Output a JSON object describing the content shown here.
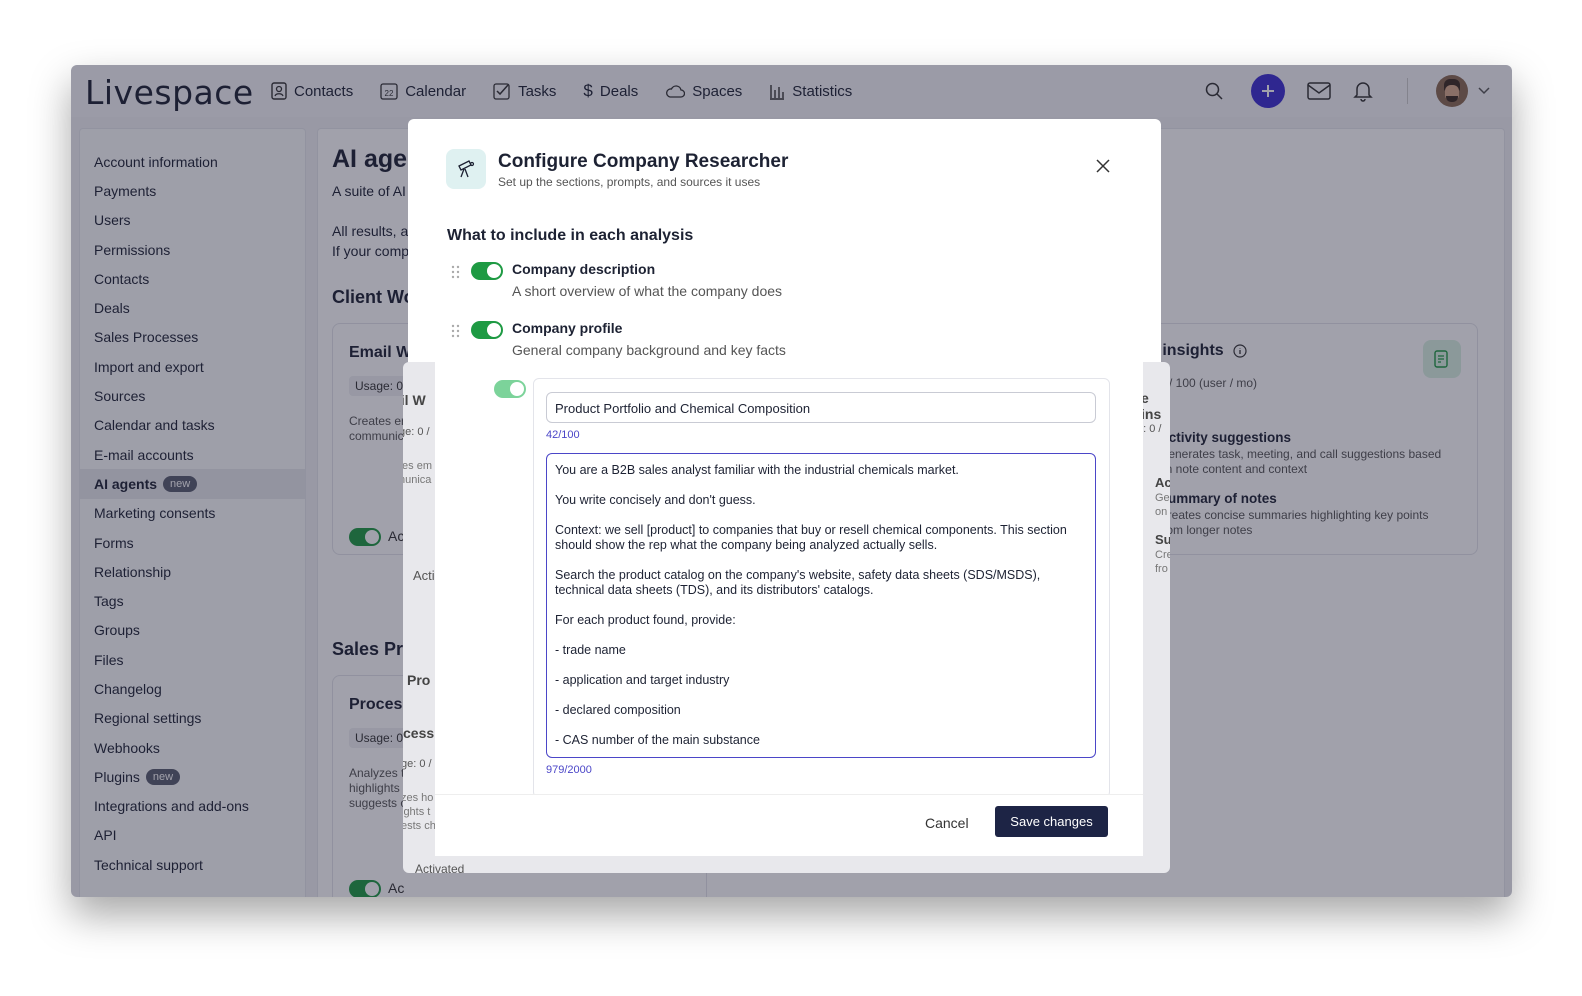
{
  "app": {
    "logo": "Livespace",
    "nav": [
      "Contacts",
      "Calendar",
      "Tasks",
      "Deals",
      "Spaces",
      "Statistics"
    ],
    "calendar_day": "22"
  },
  "sidebar": {
    "items": [
      {
        "label": "Account information"
      },
      {
        "label": "Payments"
      },
      {
        "label": "Users"
      },
      {
        "label": "Permissions"
      },
      {
        "label": "Contacts"
      },
      {
        "label": "Deals"
      },
      {
        "label": "Sales Processes"
      },
      {
        "label": "Import and export"
      },
      {
        "label": "Sources"
      },
      {
        "label": "Calendar and tasks"
      },
      {
        "label": "E-mail accounts"
      },
      {
        "label": "AI agents",
        "badge": "new",
        "active": true
      },
      {
        "label": "Marketing consents"
      },
      {
        "label": "Forms"
      },
      {
        "label": "Relationship"
      },
      {
        "label": "Tags"
      },
      {
        "label": "Groups"
      },
      {
        "label": "Files"
      },
      {
        "label": "Changelog"
      },
      {
        "label": "Regional settings"
      },
      {
        "label": "Webhooks"
      },
      {
        "label": "Plugins",
        "badge": "new"
      },
      {
        "label": "Integrations and add-ons"
      },
      {
        "label": "API"
      },
      {
        "label": "Technical support"
      }
    ]
  },
  "main": {
    "title": "AI agen",
    "subtitle": "A suite of AI",
    "p1": "All results, a",
    "p2": "If your comp",
    "section_client": "Client Wo",
    "section_sales": "Sales Pro",
    "card_email": {
      "title": "Email W",
      "usage": "Usage: 0",
      "desc1": "Creates er",
      "desc2": "communic",
      "toggle_label": "Ac"
    },
    "card_process": {
      "title": "Process",
      "usage": "Usage: 0",
      "desc1": "Analyzes t",
      "desc2": "highlights",
      "desc3": "suggests c",
      "toggle_label": "Ac"
    },
    "card_insights": {
      "title": "e insights",
      "usage": "0 / 100 (user / mo)",
      "items": [
        {
          "title": "Activity suggestions",
          "desc1": "Generates task, meeting, and call suggestions based",
          "desc2": "on note content and context"
        },
        {
          "title": "Summary of notes",
          "desc1": "Creates concise summaries highlighting key points",
          "desc2": "from longer notes"
        }
      ]
    }
  },
  "modal": {
    "title": "Configure Company Researcher",
    "subtitle": "Set up the sections, prompts, and sources it uses",
    "section_title": "What to include in each analysis",
    "rows": [
      {
        "title": "Company description",
        "desc": "A short overview of what the company does"
      },
      {
        "title": "Company profile",
        "desc": "General company background and key facts"
      }
    ],
    "field_value": "Product Portfolio and Chemical Composition",
    "field_counter": "42/100",
    "prompt": "You are a B2B sales analyst familiar with the industrial chemicals market.\n\nYou write concisely and don't guess.\n\nContext: we sell [product] to companies that buy or resell chemical components. This section should show the rep what the company being analyzed actually sells.\n\nSearch the product catalog on the company's website, safety data sheets (SDS/MSDS), technical data sheets (TDS), and its distributors' catalogs.\n\nFor each product found, provide:\n\n- trade name\n\n- application and target industry\n\n- declared composition\n\n- CAS number of the main substance",
    "prompt_counter": "979/2000",
    "cancel": "Cancel",
    "save": "Save changes"
  },
  "behind": {
    "l1": "ail W",
    "l2": "ge: 0 /",
    "l3": "tes em",
    "l4": "nunica",
    "l5": "Acti",
    "l6": "Pro",
    "l7": "cess",
    "l8": "ge: 0 /",
    "l9": "zes ho",
    "l10": "ights t",
    "l11": "ests ch",
    "l12": "Activated",
    "r1": "e ins",
    "r2": "e: 0 /",
    "r3": "Ac",
    "r4": "Ge",
    "r5": "on",
    "r6": "Su",
    "r7": "Cre",
    "r8": "fro"
  },
  "colors": {
    "accent": "#3b2ed0",
    "toggle_on": "#1e9a43",
    "save_btn": "#1d2445",
    "focus": "#4b46c8"
  }
}
